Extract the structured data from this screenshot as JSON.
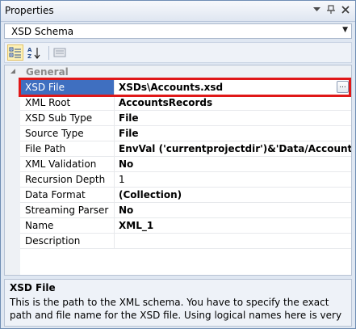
{
  "window": {
    "title": "Properties",
    "buttons": [
      "dropdown-icon",
      "pin-icon",
      "close-icon"
    ]
  },
  "object_selector": {
    "value": "XSD Schema"
  },
  "toolbar": {
    "buttons": [
      "categorized-icon",
      "alphabetical-icon",
      "property-pages-icon"
    ],
    "active": "categorized-icon"
  },
  "grid": {
    "category": "General",
    "selected": "XSD File",
    "properties": [
      {
        "name": "XSD File",
        "value": "XSDs\\Accounts.xsd",
        "bold": true,
        "has_ellipsis": true
      },
      {
        "name": "XML Root",
        "value": "AccountsRecords",
        "bold": true
      },
      {
        "name": "XSD Sub Type",
        "value": "File",
        "bold": true
      },
      {
        "name": "Source Type",
        "value": "File",
        "bold": true
      },
      {
        "name": "File Path",
        "value": "EnvVal ('currentprojectdir')&'Data/Accounts.xml'",
        "bold": true
      },
      {
        "name": "XML Validation",
        "value": "No",
        "bold": true
      },
      {
        "name": "Recursion Depth",
        "value": "1",
        "bold": false
      },
      {
        "name": "Data Format",
        "value": "(Collection)",
        "bold": true
      },
      {
        "name": "Streaming Parser",
        "value": "No",
        "bold": true
      },
      {
        "name": "Name",
        "value": "XML_1",
        "bold": true
      },
      {
        "name": "Description",
        "value": "",
        "bold": false
      }
    ],
    "ellipsis_label": "..."
  },
  "description": {
    "title": "XSD File",
    "text": "This is the path to the XML schema. You have to specify the exact path and file name for the XSD file. Using logical names here is very useful during deploym..."
  },
  "colors": {
    "selection": "#3f6fc0",
    "highlight": "#e01818"
  }
}
